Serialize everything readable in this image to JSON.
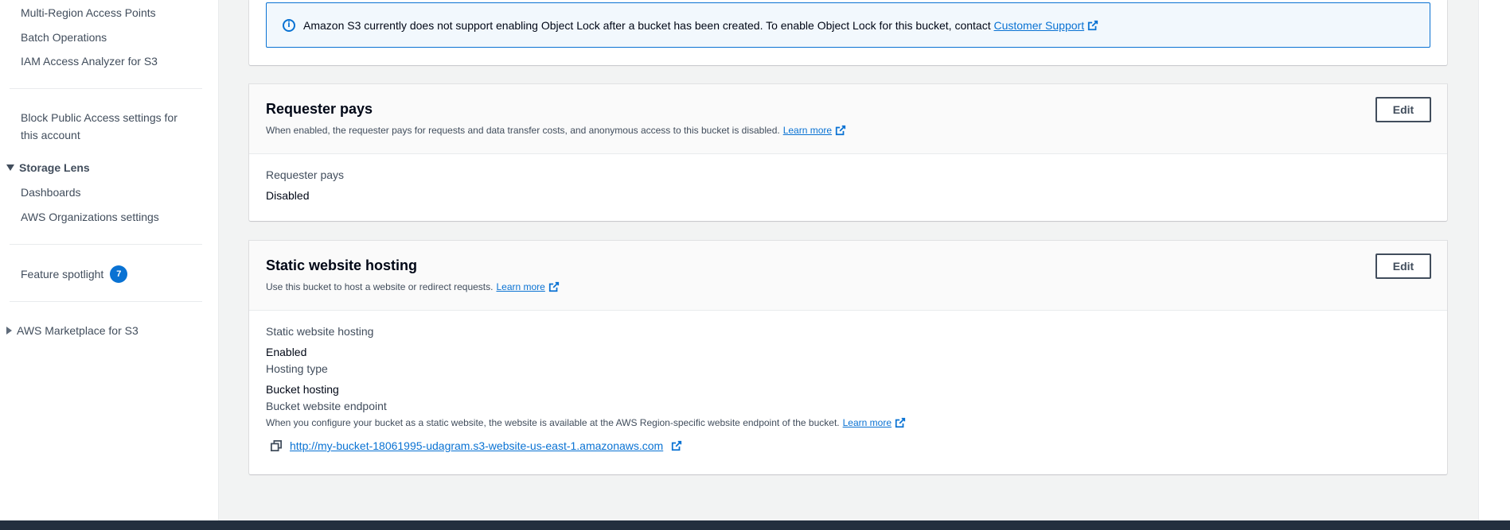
{
  "sidebar": {
    "items_top": [
      {
        "label": "Multi-Region Access Points"
      },
      {
        "label": "Batch Operations"
      },
      {
        "label": "IAM Access Analyzer for S3"
      }
    ],
    "block_public_access_line1": "Block Public Access settings for",
    "block_public_access_line2": "this account",
    "storage_lens": {
      "label": "Storage Lens",
      "items": [
        {
          "label": "Dashboards"
        },
        {
          "label": "AWS Organizations settings"
        }
      ]
    },
    "feature_spotlight": {
      "label": "Feature spotlight",
      "badge": "7"
    },
    "marketplace": {
      "label": "AWS Marketplace for S3"
    }
  },
  "object_lock_notice": {
    "text": "Amazon S3 currently does not support enabling Object Lock after a bucket has been created. To enable Object Lock for this bucket, contact",
    "link": "Customer Support"
  },
  "requester_pays": {
    "title": "Requester pays",
    "description": "When enabled, the requester pays for requests and data transfer costs, and anonymous access to this bucket is disabled.",
    "learn_more": "Learn more",
    "edit_label": "Edit",
    "field_label": "Requester pays",
    "field_value": "Disabled"
  },
  "static_website": {
    "title": "Static website hosting",
    "description": "Use this bucket to host a website or redirect requests.",
    "learn_more": "Learn more",
    "edit_label": "Edit",
    "hosting_label": "Static website hosting",
    "hosting_value": "Enabled",
    "type_label": "Hosting type",
    "type_value": "Bucket hosting",
    "endpoint_label": "Bucket website endpoint",
    "endpoint_desc": "When you configure your bucket as a static website, the website is available at the AWS Region-specific website endpoint of the bucket.",
    "endpoint_learn_more": "Learn more",
    "endpoint_url": "http://my-bucket-18061995-udagram.s3-website-us-east-1.amazonaws.com"
  },
  "colors": {
    "link": "#0972d3",
    "footer": "#232f3e",
    "info_bg": "#f2f8fd"
  }
}
